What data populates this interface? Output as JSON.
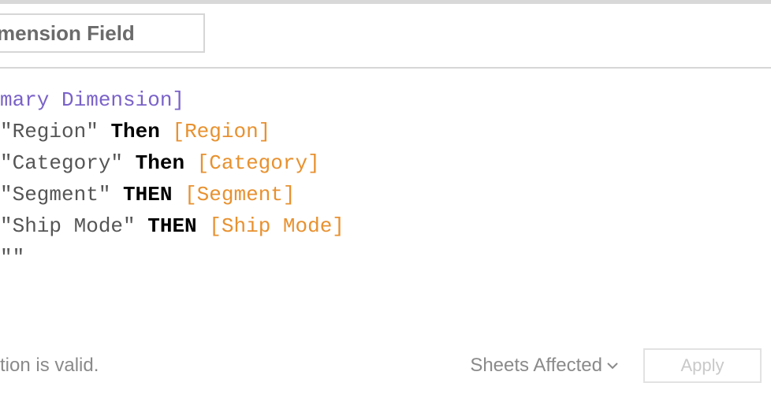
{
  "calc_name": "mension Field",
  "code": {
    "line1_param": "mary Dimension]",
    "rows": [
      {
        "str": "\"Region\"",
        "kw": "Then",
        "field": "[Region]"
      },
      {
        "str": "\"Category\"",
        "kw": "Then",
        "field": "[Category]"
      },
      {
        "str": "\"Segment\"",
        "kw": "THEN",
        "field": "[Segment]"
      },
      {
        "str": "\"Ship Mode\"",
        "kw": "THEN",
        "field": "[Ship Mode]"
      }
    ],
    "last_line": "\"\""
  },
  "footer": {
    "status": "tion is valid.",
    "sheets_affected": "Sheets Affected",
    "apply": "Apply"
  }
}
